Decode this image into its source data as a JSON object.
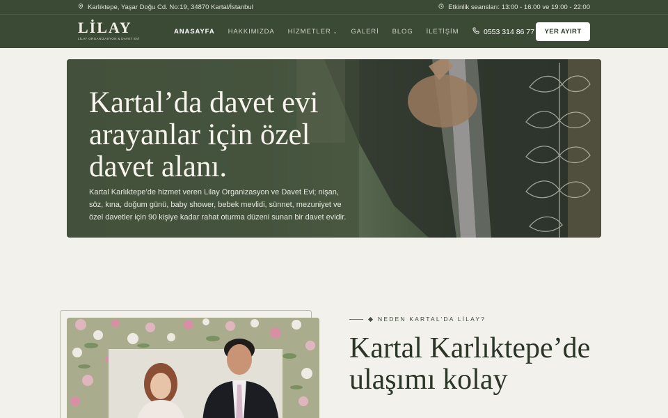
{
  "topbar": {
    "address": "Karlıktepe, Yaşar Doğu Cd. No:19, 34870 Kartal/İstanbul",
    "sessions": "Etkinlik seansları: 13:00 - 16:00 ve 19:00 - 22:00"
  },
  "header": {
    "logo_word": "LİLAY",
    "logo_sub": "LİLAY ORGANİZASYON & DAVET EVİ",
    "nav": [
      "ANASAYFA",
      "HAKKIMIZDA",
      "HİZMETLER",
      "GALERİ",
      "BLOG",
      "İLETİŞİM"
    ],
    "phone": "0553 314 86 77",
    "cta": "YER AYIRT"
  },
  "hero": {
    "title": "Kartal’da davet evi arayanlar için özel davet alanı.",
    "description": "Kartal Karlıktepe’de hizmet veren Lilay Organizasyon ve Davet Evi; nişan, söz, kına, doğum günü, baby shower, bebek mevlidi, sünnet, mezuniyet ve özel davetler için 90 kişiye kadar rahat oturma düzeni sunan bir davet evidir."
  },
  "section": {
    "eyebrow": "NEDEN KARTAL’DA LİLAY?",
    "title": "Kartal Karlıktepe’de ulaşımı kolay"
  },
  "colors": {
    "brand_dark": "#3b4a35",
    "background": "#f2f1ec",
    "cta_bg": "#ffffff"
  }
}
